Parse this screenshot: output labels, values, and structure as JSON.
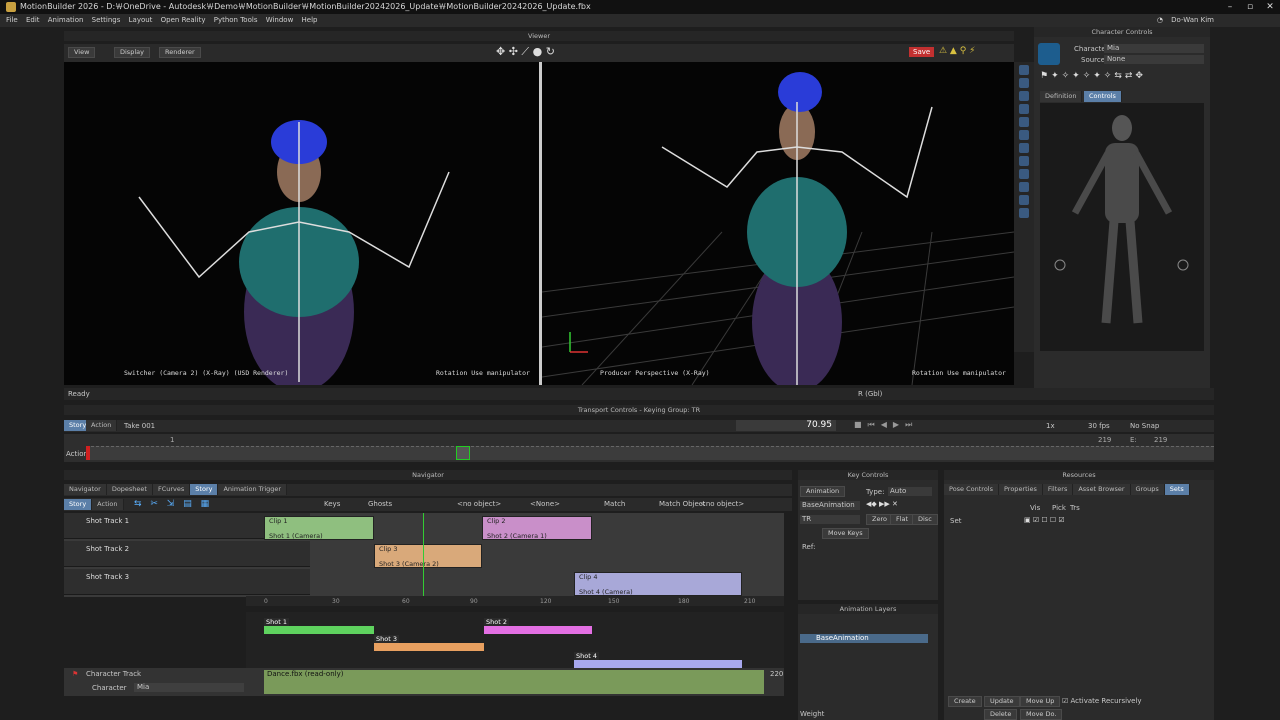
{
  "title": "MotionBuilder 2026 - D:￦OneDrive - Autodesk￦Demo￦MotionBuilder￦MotionBuilder20242026_Update￦MotionBuilder20242026_Update.fbx",
  "user": "Do-Wan Kim",
  "menu": [
    "File",
    "Edit",
    "Animation",
    "Settings",
    "Layout",
    "Open Reality",
    "Python Tools",
    "Window",
    "Help"
  ],
  "viewer": {
    "title": "Viewer",
    "view_btn": "View",
    "display_btn": "Display",
    "renderer_btn": "Renderer",
    "save": "Save",
    "left_label": "Switcher (Camera 2) (X-Ray) (USD Renderer)",
    "left_rot": "Rotation  Use manipulator",
    "right_label": "Producer Perspective (X-Ray)",
    "right_rot": "Rotation  Use manipulator"
  },
  "character_controls": {
    "title": "Character Controls",
    "character_label": "Character",
    "character_value": "Mia",
    "source_label": "Source",
    "source_value": "None",
    "tab_definition": "Definition",
    "tab_controls": "Controls"
  },
  "status": {
    "ready": "Ready",
    "rgbl": "R (Gbl)"
  },
  "transport": {
    "title": "Transport Controls  -  Keying Group: TR",
    "tab_story": "Story",
    "tab_action": "Action",
    "take": "Take 001",
    "time": "70.95",
    "speed": "1x",
    "fps": "30 fps",
    "snap": "No Snap",
    "end1": "219",
    "end_label": "E:",
    "end2": "219",
    "action": "Action",
    "start": "0",
    "one": "1"
  },
  "navigator": {
    "title": "Navigator",
    "tabs": [
      "Navigator",
      "Dopesheet",
      "FCurves",
      "Story",
      "Animation Trigger"
    ],
    "sub_story": "Story",
    "sub_action": "Action",
    "keys": "Keys",
    "ghosts": "Ghosts",
    "no_object": "<no object>",
    "none": "<None>",
    "match": "Match",
    "match_object": "Match Object",
    "no_object2": "<no object>"
  },
  "tracks": [
    {
      "name": "Shot Track 1"
    },
    {
      "name": "Shot Track 2"
    },
    {
      "name": "Shot Track 3"
    }
  ],
  "clips": [
    {
      "name": "Clip 1",
      "sub": "Shot 1 (Camera)"
    },
    {
      "name": "Clip 2",
      "sub": "Shot 2 (Camera 1)"
    },
    {
      "name": "Clip 3",
      "sub": "Shot 3 (Camera 2)"
    },
    {
      "name": "Clip 4",
      "sub": "Shot 4 (Camera)"
    }
  ],
  "ruler": [
    "0",
    "30",
    "60",
    "90",
    "120",
    "150",
    "180",
    "210"
  ],
  "shots": [
    "Shot 1",
    "Shot 2",
    "Shot 3",
    "Shot 4"
  ],
  "character_track": {
    "name": "Character Track",
    "char_label": "Character",
    "char_value": "Mia",
    "clip": "Dance.fbx (read-only)",
    "v220": "220"
  },
  "key_controls": {
    "title": "Key Controls",
    "animation": "Animation",
    "type_label": "Type:",
    "type_value": "Auto",
    "base": "BaseAnimation",
    "tr": "TR",
    "zero": "Zero",
    "flat": "Flat",
    "disc": "Disc",
    "move_keys": "Move Keys",
    "ref": "Ref:"
  },
  "anim_layers": {
    "title": "Animation Layers",
    "base": "BaseAnimation",
    "weight": "Weight"
  },
  "resources": {
    "title": "Resources",
    "tabs": [
      "Pose Controls",
      "Properties",
      "Filters",
      "Asset Browser",
      "Groups",
      "Sets"
    ],
    "set": "Set",
    "vis": "Vis",
    "pick": "Pick",
    "trs": "Trs",
    "create": "Create",
    "update": "Update",
    "move_up": "Move Up",
    "delete": "Delete",
    "move_down": "Move Do.",
    "activate": "Activate Recursively"
  },
  "colors": {
    "accent": "#5b7fa8",
    "clip_green": "#8fbf7f",
    "clip_pink": "#c98fc9",
    "clip_orange": "#d9a97a",
    "clip_purple": "#a8a8d8",
    "shot_green": "#5fd35f",
    "shot_pink": "#e36fe3",
    "shot_orange": "#e8a060",
    "shot_purple": "#a8a8ef"
  }
}
